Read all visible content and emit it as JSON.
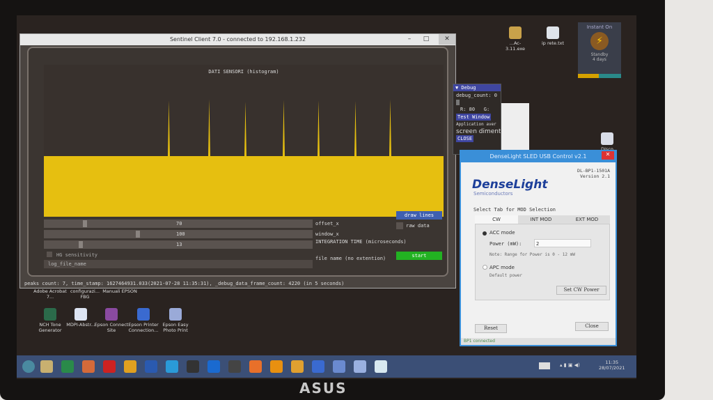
{
  "sentinel": {
    "title": "Sentinel Client 7.0 - connected to 192.168.1.232",
    "plot_title": "DATI SENSORI (histogram)",
    "histogram": {
      "baseline_fraction": 0.4,
      "spike_heights_relative": [
        0.95,
        0.97,
        0.93,
        0.96,
        0.95,
        0.94,
        0.97
      ]
    },
    "offset_x_label": "offset_x",
    "offset_x_value": "70",
    "window_x_label": "window_x",
    "window_x_value": "100",
    "integration_label": "INTEGRATION TIME (microseconds)",
    "integration_value": "13",
    "hi_sens": "HG sensitivity",
    "file_name_label": "file name (no extention)",
    "log_placeholder": "log_file_name",
    "draw_lines": "draw lines",
    "raw_data": "raw data",
    "start": "start",
    "status": "peaks count: 7, time_stamp: 1627464931.033(2021-07-28 11:35:31), _debug_data_frame_count: 4220 (in 5 seconds)"
  },
  "debug": {
    "title": "▼ Debug",
    "count": "debug_count: 0",
    "r": "R: 80",
    "g": "G:",
    "test_window": "Test Window",
    "app": "Application aver",
    "screen": "screen diment",
    "close": "CLOSE"
  },
  "denselight": {
    "title": "DenseLight SLED USB Control v2.1",
    "model": "DL-BP1-1501A",
    "version": "Version 2.1",
    "logo": "DenseLight",
    "logo_sub": "Semiconductors",
    "select_tab": "Select Tab for MOD Selection",
    "tabs": [
      "CW",
      "INT MOD",
      "EXT MOD"
    ],
    "acc_mode": "ACC mode",
    "power_label": "Power (mW):",
    "power_value": "2",
    "note": "Note: Range for Power is 0 - 12 mW",
    "apc_mode": "APC mode",
    "default_power": "Default power",
    "set_cw": "Set CW Power",
    "reset": "Reset",
    "close": "Close",
    "status": "BP1 connected"
  },
  "instant_on": {
    "title": "Instant On",
    "state": "Standby",
    "days": "4 days"
  },
  "desktop_top": [
    "...Ac-3.11.exe",
    "ip rete.txt",
    "Disco"
  ],
  "desktop_row1": [
    "Adobe Acrobat 7...",
    "configurazi... FBG",
    "Manuali EPSON"
  ],
  "desktop_row2": [
    "NCH Tone Generator",
    "MDPI-Abstr...",
    "Epson Connect Site",
    "Epson Printer Connection...",
    "Epson Easy Photo Print"
  ],
  "clock": {
    "time": "11:35",
    "date": "28/07/2021"
  },
  "brand": "ASUS",
  "colors": {
    "yellow": "#e6bf10",
    "start": "#22b222",
    "draw": "#3f5fb0",
    "dl_blue": "#3a8fd8"
  }
}
